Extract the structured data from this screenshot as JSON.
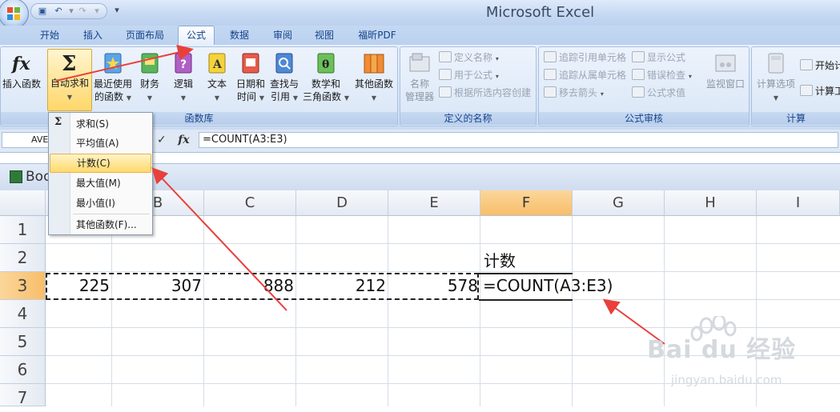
{
  "app": {
    "title": "Microsoft Excel"
  },
  "tabs": [
    {
      "label": "开始"
    },
    {
      "label": "插入"
    },
    {
      "label": "页面布局"
    },
    {
      "label": "公式"
    },
    {
      "label": "数据"
    },
    {
      "label": "审阅"
    },
    {
      "label": "视图"
    },
    {
      "label": "福昕PDF"
    }
  ],
  "ribbon": {
    "function_library": {
      "label": "函数库",
      "insert_function": "插入函数",
      "autosum": "自动求和",
      "recent_1": "最近使用",
      "recent_2": "的函数",
      "finance": "财务",
      "logic": "逻辑",
      "text": "文本",
      "datetime_1": "日期和",
      "datetime_2": "时间",
      "lookup_1": "查找与",
      "lookup_2": "引用",
      "math_1": "数学和",
      "math_2": "三角函数",
      "other": "其他函数"
    },
    "defined_names": {
      "label": "定义的名称",
      "name_manager_1": "名称",
      "name_manager_2": "管理器",
      "define_name": "定义名称",
      "use_in_formula": "用于公式",
      "create_from_selection": "根据所选内容创建"
    },
    "formula_auditing": {
      "label": "公式审核",
      "trace_precedents": "追踪引用单元格",
      "trace_dependents": "追踪从属单元格",
      "remove_arrows": "移去箭头",
      "show_formulas": "显示公式",
      "error_checking": "错误检查",
      "evaluate_formula": "公式求值",
      "watch_window": "监视窗口"
    },
    "calculation": {
      "label": "计算",
      "calc_options": "计算选项",
      "calc_now": "开始计",
      "calc_sheet": "计算工"
    }
  },
  "formula_bar": {
    "name_box": "AVE",
    "fx": "fx",
    "check": "✓",
    "formula": "=COUNT(A3:E3)"
  },
  "workbook": {
    "title": "Boo"
  },
  "columns": [
    "B",
    "C",
    "D",
    "E",
    "F",
    "G",
    "H",
    "I"
  ],
  "rows": [
    "1",
    "2",
    "3",
    "4",
    "5",
    "6",
    "7"
  ],
  "cells": {
    "F2": "计数",
    "A3": "225",
    "B3": "307",
    "C3": "888",
    "D3": "212",
    "E3": "578",
    "F3": "=COUNT(A3:E3)"
  },
  "dropdown": {
    "items": [
      {
        "label": "求和(S)",
        "icon": "sigma-icon"
      },
      {
        "label": "平均值(A)"
      },
      {
        "label": "计数(C)",
        "highlighted": true
      },
      {
        "label": "最大值(M)"
      },
      {
        "label": "最小值(I)"
      },
      {
        "label": "其他函数(F)..."
      }
    ]
  },
  "watermark": {
    "brand": "Bai du 经验",
    "url": "jingyan.baidu.com"
  },
  "colors": {
    "accent": "#e8413c",
    "selected_header": "#f8bd6a",
    "ribbon": "#d7e4f6"
  }
}
